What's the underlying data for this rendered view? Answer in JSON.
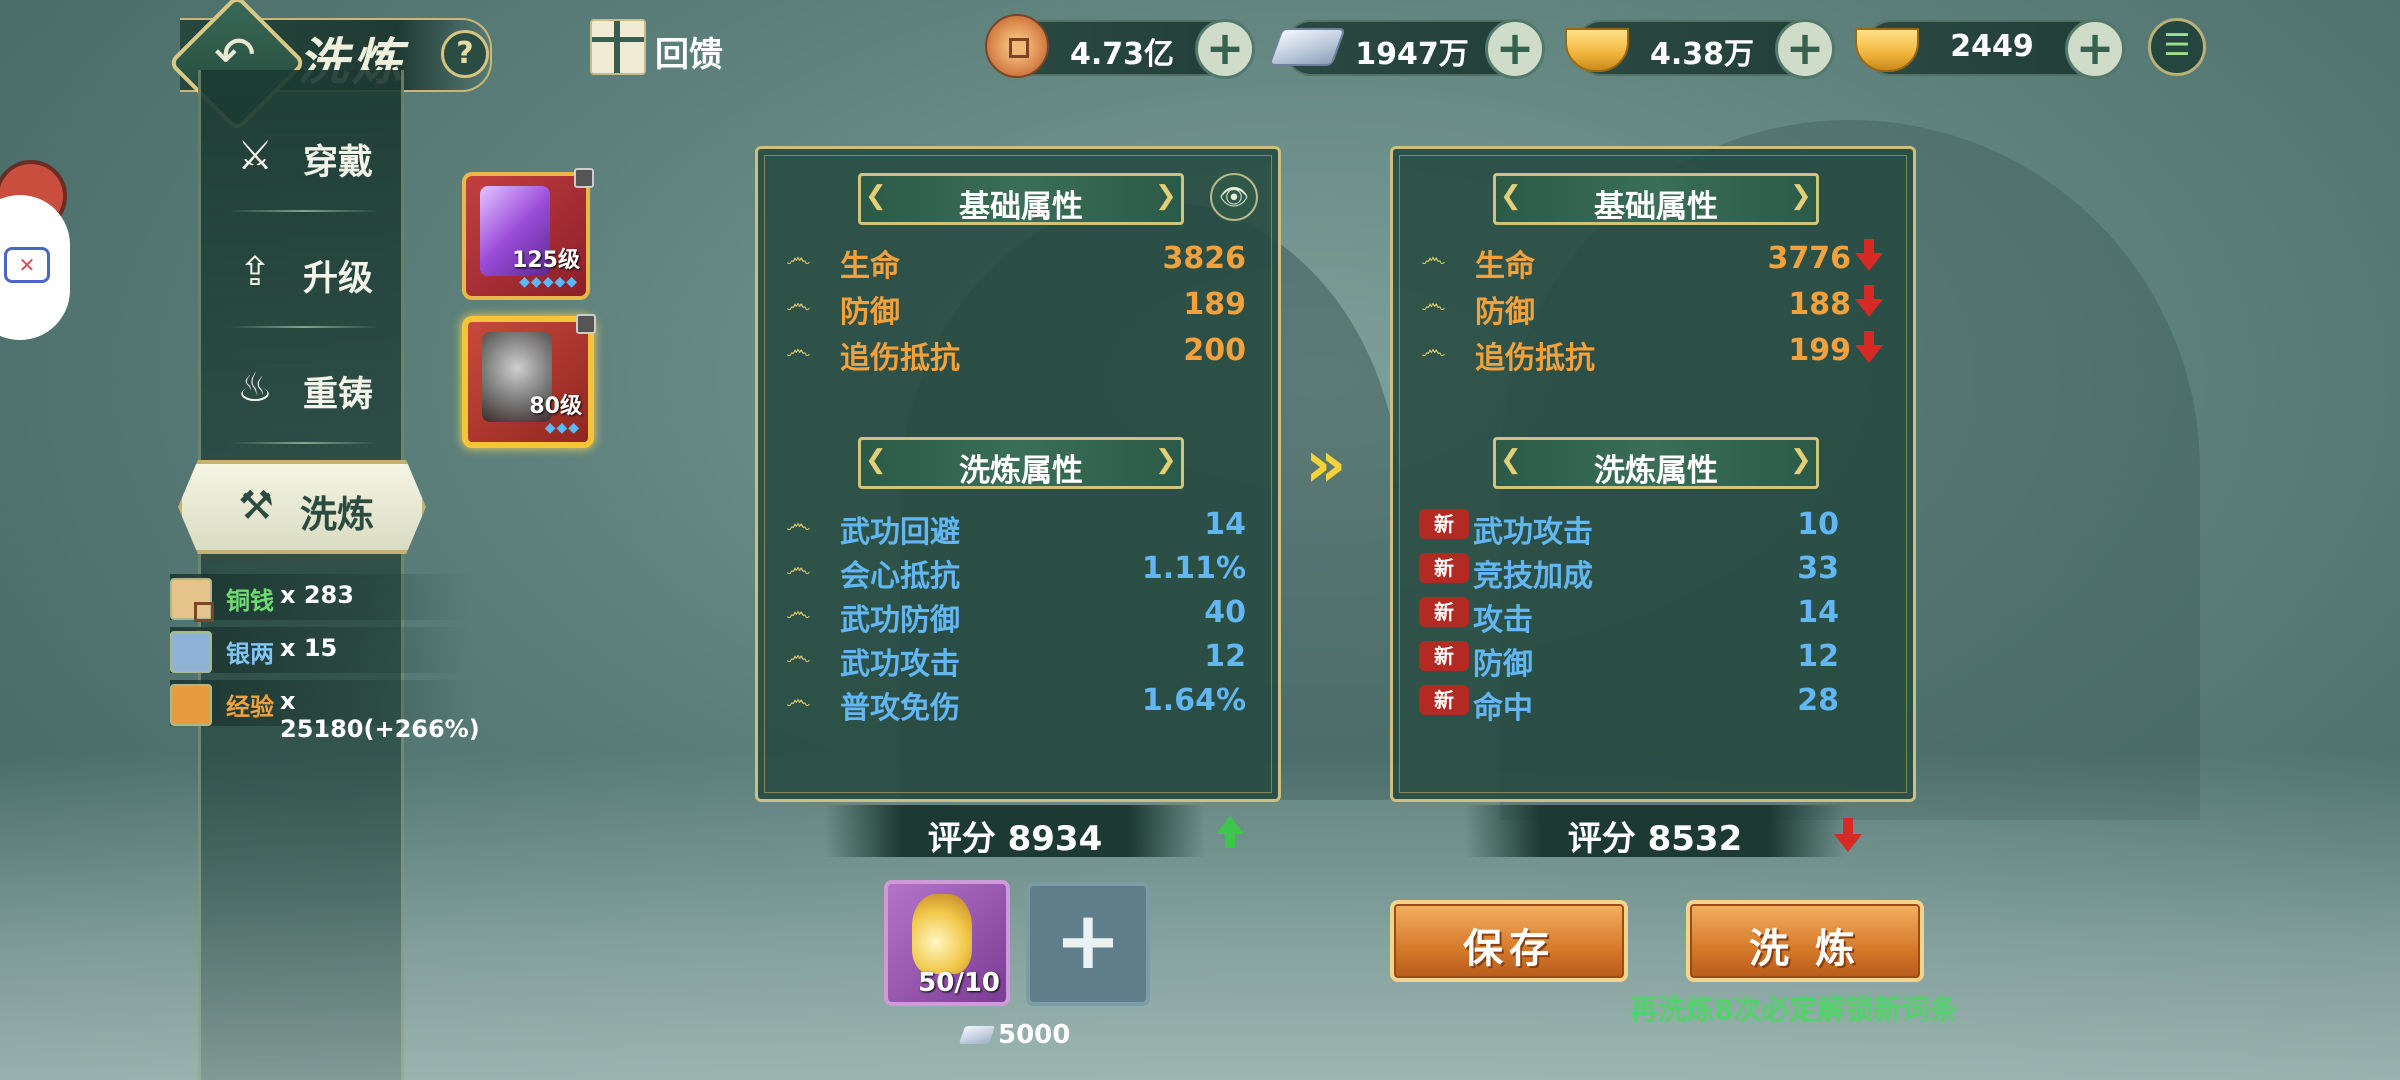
{
  "header": {
    "title": "洗炼",
    "help": "?",
    "feedback_label": "回馈"
  },
  "currencies": [
    {
      "name": "copper-coin",
      "value": "4.73亿"
    },
    {
      "name": "silver",
      "value": "1947万"
    },
    {
      "name": "gold-ingot-locked",
      "value": "4.38万"
    },
    {
      "name": "gold-ingot",
      "value": "2449"
    }
  ],
  "nav": {
    "items": [
      {
        "label": "穿戴",
        "icon": "crossed-swords-icon"
      },
      {
        "label": "升级",
        "icon": "upgrade-arrow-icon"
      },
      {
        "label": "重铸",
        "icon": "flame-icon"
      }
    ],
    "active": {
      "label": "洗炼",
      "icon": "anvil-icon"
    }
  },
  "costs": [
    {
      "name": "铜钱",
      "amount": "x 283",
      "color": "#6fdc73"
    },
    {
      "name": "银两",
      "amount": "x 15",
      "color": "#7fc4f2"
    },
    {
      "name": "经验",
      "amount": "x 25180(+266%)",
      "color": "#f2a13c"
    }
  ],
  "equipment": [
    {
      "level": "125级",
      "gems": "◆◆◆◆◆"
    },
    {
      "level": "80级",
      "gems": "◆◆◆"
    }
  ],
  "current": {
    "base_title": "基础属性",
    "base": [
      {
        "name": "生命",
        "value": "3826"
      },
      {
        "name": "防御",
        "value": "189"
      },
      {
        "name": "追伤抵抗",
        "value": "200"
      }
    ],
    "refine_title": "洗炼属性",
    "refine": [
      {
        "name": "武功回避",
        "value": "14"
      },
      {
        "name": "会心抵抗",
        "value": "1.11%"
      },
      {
        "name": "武功防御",
        "value": "40"
      },
      {
        "name": "武功攻击",
        "value": "12"
      },
      {
        "name": "普攻免伤",
        "value": "1.64%"
      }
    ],
    "score": "评分 8934"
  },
  "preview": {
    "base_title": "基础属性",
    "base": [
      {
        "name": "生命",
        "value": "3776"
      },
      {
        "name": "防御",
        "value": "188"
      },
      {
        "name": "追伤抵抗",
        "value": "199"
      }
    ],
    "refine_title": "洗炼属性",
    "new_tag": "新",
    "refine": [
      {
        "name": "武功攻击",
        "value": "10"
      },
      {
        "name": "竞技加成",
        "value": "33"
      },
      {
        "name": "攻击",
        "value": "14"
      },
      {
        "name": "防御",
        "value": "12"
      },
      {
        "name": "命中",
        "value": "28"
      }
    ],
    "score": "评分 8532"
  },
  "material": {
    "count": "50/10",
    "silver_cost": "5000"
  },
  "buttons": {
    "save": "保存",
    "refine": "洗 炼"
  },
  "hint": "再洗炼8次必定解锁新词条"
}
